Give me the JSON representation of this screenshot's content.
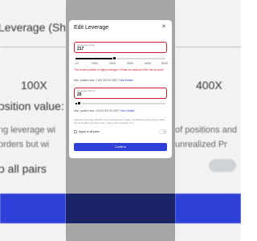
{
  "background": {
    "left": {
      "heading": "Leverage (Short)",
      "value_fragment": "100X",
      "position_fragment": "osition value: 3",
      "adjust_fragment": "ng leverage wi",
      "orders_fragment": "orders but wi",
      "pairs_fragment": "o all pairs"
    },
    "right": {
      "value_fragment": "400X",
      "positions_fragment": "of positions and",
      "unrealized_fragment": "unrealized Pr"
    },
    "colors": {
      "blue_band": "#2f40d8"
    }
  },
  "modal": {
    "title": "Edit Leverage",
    "close_icon": "close-icon",
    "long_field": {
      "label": "Leverage (Long)",
      "value": "217"
    },
    "long_slider": {
      "fraction": 0.43,
      "ticks": [
        "1X",
        "100X",
        "200X",
        "300X",
        "400X",
        "500X"
      ]
    },
    "warning": "The current position is highly leveraged. Please be cautious of the risk involved.",
    "long_max": {
      "label": "Max. position size: 2,000,000.00 USDT",
      "link": "View Details"
    },
    "short_field": {
      "label": "Leverage (Short)",
      "value": "20"
    },
    "short_slider": {
      "fraction": 0.04
    },
    "short_max": {
      "label": "Max. position size: 20,000,000.00 USDT",
      "link": "View Details"
    },
    "note": "Adjusting leverage will affect the leverage and margin of positions and pending orders but won't affect positions size, value and unrealized PnL.",
    "apply_all_label": "Apply to all pairs",
    "confirm_label": "Confirm",
    "colors": {
      "accent": "#2f40d8",
      "warning": "#d11a2a"
    }
  }
}
